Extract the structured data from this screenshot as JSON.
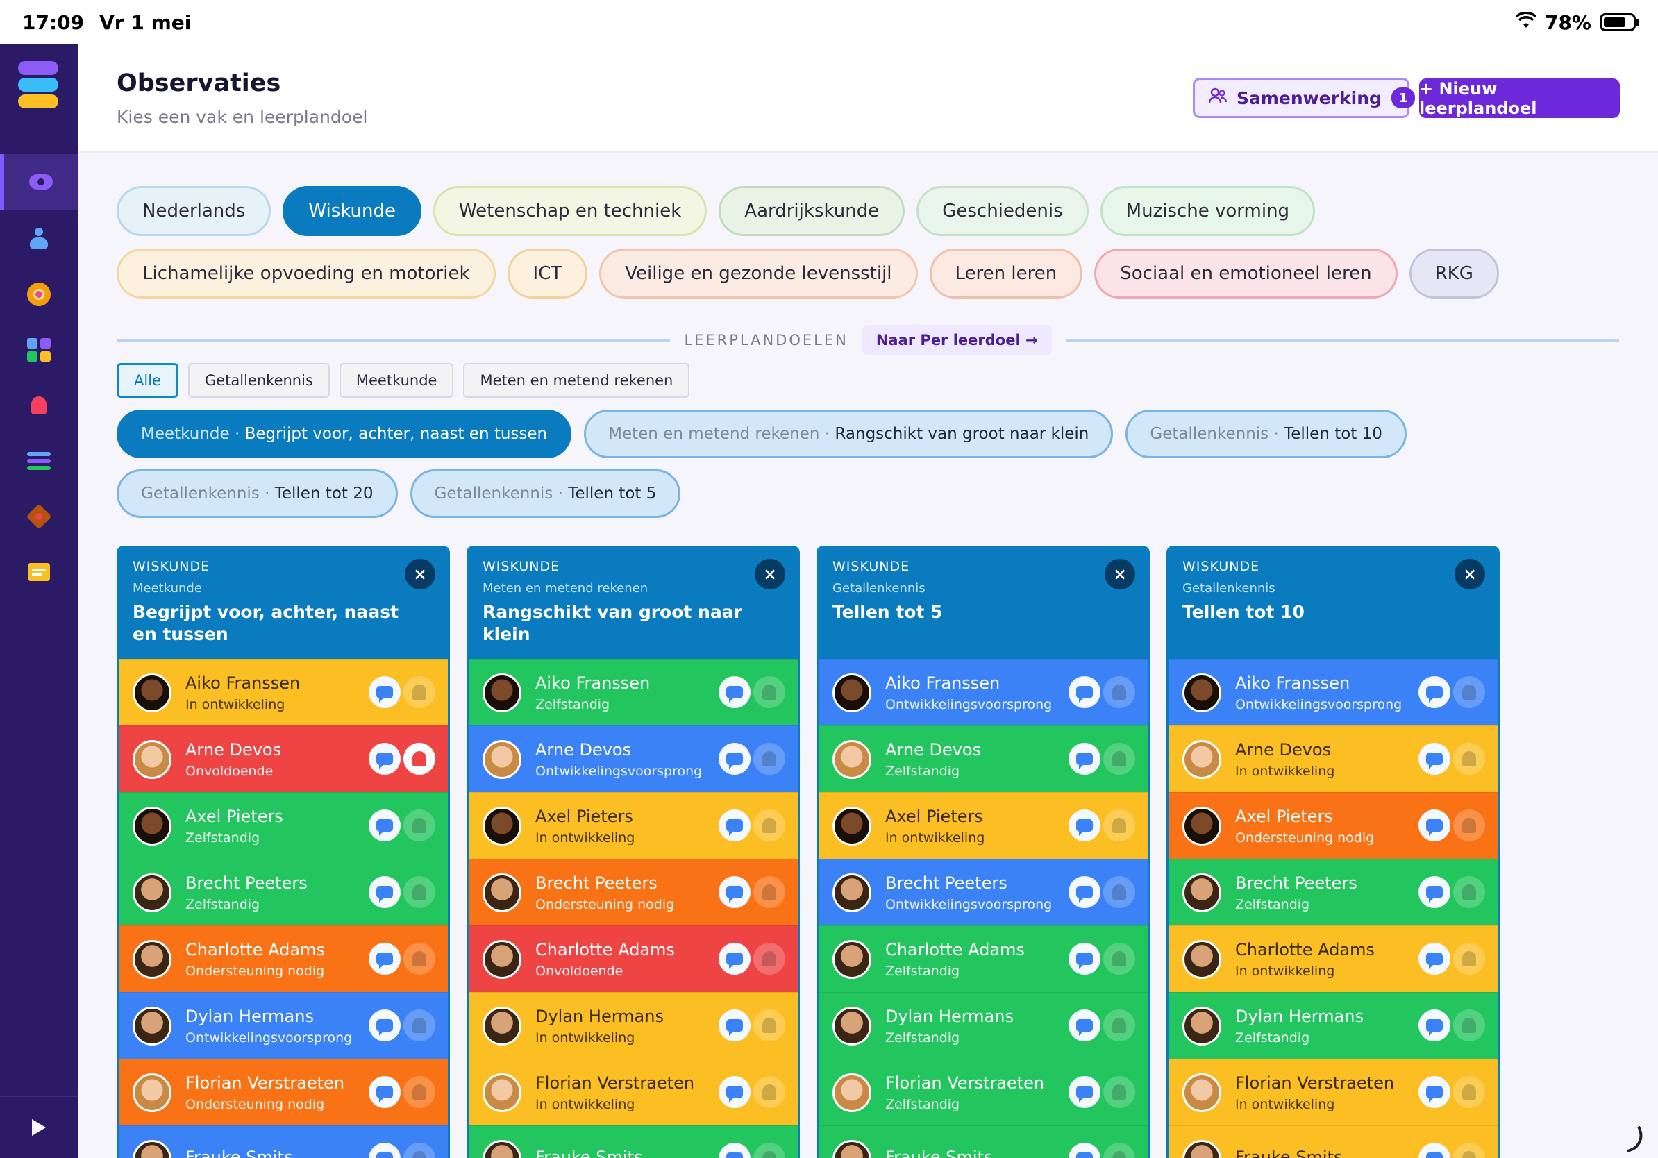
{
  "statusbar": {
    "time": "17:09",
    "date": "Vr 1 mei",
    "battery": "78%"
  },
  "header": {
    "title": "Observaties",
    "subtitle": "Kies een vak en leerplandoel",
    "collab_label": "Samenwerking",
    "collab_count": "1",
    "new_label": "+ Nieuw leerplandoel"
  },
  "subjects": [
    {
      "label": "Nederlands",
      "bg": "#e6f1f8",
      "border": "#b9d8ec",
      "active": false
    },
    {
      "label": "Wiskunde",
      "bg": "#0b7bc0",
      "border": "#0b7bc0",
      "active": true
    },
    {
      "label": "Wetenschap en techniek",
      "bg": "#f2f6e2",
      "border": "#d6e4ae",
      "active": false
    },
    {
      "label": "Aardrijkskunde",
      "bg": "#e8f3e6",
      "border": "#c2dcbd",
      "active": false
    },
    {
      "label": "Geschiedenis",
      "bg": "#e9f5ea",
      "border": "#c5e2c9",
      "active": false
    },
    {
      "label": "Muzische vorming",
      "bg": "#e6f6e9",
      "border": "#bfe5c7",
      "active": false
    },
    {
      "label": "Lichamelijke opvoeding en motoriek",
      "bg": "#fbf1de",
      "border": "#f2d89e",
      "active": false
    },
    {
      "label": "ICT",
      "bg": "#fbf1de",
      "border": "#f0d39a",
      "active": false
    },
    {
      "label": "Veilige en gezonde levensstijl",
      "bg": "#fcebe2",
      "border": "#f2c6ad",
      "active": false
    },
    {
      "label": "Leren leren",
      "bg": "#fbe9e2",
      "border": "#f1bfa9",
      "active": false
    },
    {
      "label": "Sociaal en emotioneel leren",
      "bg": "#fbe4e7",
      "border": "#f0a8b2",
      "active": false
    },
    {
      "label": "RKG",
      "bg": "#e6e6f4",
      "border": "#c3c3e0",
      "active": false
    }
  ],
  "leerplandoelen": {
    "label": "LEERPLANDOELEN",
    "link": "Naar Per leerdoel →"
  },
  "filters": [
    {
      "label": "Alle",
      "active": true
    },
    {
      "label": "Getallenkennis",
      "active": false
    },
    {
      "label": "Meetkunde",
      "active": false
    },
    {
      "label": "Meten en metend rekenen",
      "active": false
    }
  ],
  "goals": [
    {
      "domain": "Meetkunde",
      "sep": " · ",
      "goal": "Begrijpt voor, achter, naast en tussen",
      "active": true
    },
    {
      "domain": "Meten en metend rekenen",
      "sep": " · ",
      "goal": "Rangschikt van groot naar klein",
      "active": false
    },
    {
      "domain": "Getallenkennis",
      "sep": " · ",
      "goal": "Tellen tot 10",
      "active": false
    },
    {
      "domain": "Getallenkennis",
      "sep": " · ",
      "goal": "Tellen tot 20",
      "active": false
    },
    {
      "domain": "Getallenkennis",
      "sep": " · ",
      "goal": "Tellen tot 5",
      "active": false
    }
  ],
  "columns": [
    {
      "subject": "WISKUNDE",
      "domain": "Meetkunde",
      "goal": "Begrijpt voor, achter, naast en tussen",
      "close": "×",
      "rows": [
        {
          "name": "Aiko Franssen",
          "status": "In ontwikkeling",
          "color": "yellow",
          "bell": false
        },
        {
          "name": "Arne Devos",
          "status": "Onvoldoende",
          "color": "red",
          "bell": true
        },
        {
          "name": "Axel Pieters",
          "status": "Zelfstandig",
          "color": "green",
          "bell": false
        },
        {
          "name": "Brecht Peeters",
          "status": "Zelfstandig",
          "color": "green",
          "bell": false
        },
        {
          "name": "Charlotte Adams",
          "status": "Ondersteuning nodig",
          "color": "orange",
          "bell": false
        },
        {
          "name": "Dylan Hermans",
          "status": "Ontwikkelingsvoorsprong",
          "color": "blue",
          "bell": false
        },
        {
          "name": "Florian Verstraeten",
          "status": "Ondersteuning nodig",
          "color": "orange",
          "bell": false
        },
        {
          "name": "Frauke Smits",
          "status": "",
          "color": "blue",
          "bell": false
        }
      ]
    },
    {
      "subject": "WISKUNDE",
      "domain": "Meten en metend rekenen",
      "goal": "Rangschikt van groot naar klein",
      "close": "×",
      "rows": [
        {
          "name": "Aiko Franssen",
          "status": "Zelfstandig",
          "color": "green",
          "bell": false
        },
        {
          "name": "Arne Devos",
          "status": "Ontwikkelingsvoorsprong",
          "color": "blue",
          "bell": false
        },
        {
          "name": "Axel Pieters",
          "status": "In ontwikkeling",
          "color": "yellow",
          "bell": false
        },
        {
          "name": "Brecht Peeters",
          "status": "Ondersteuning nodig",
          "color": "orange",
          "bell": false
        },
        {
          "name": "Charlotte Adams",
          "status": "Onvoldoende",
          "color": "red",
          "bell": false
        },
        {
          "name": "Dylan Hermans",
          "status": "In ontwikkeling",
          "color": "yellow",
          "bell": false
        },
        {
          "name": "Florian Verstraeten",
          "status": "In ontwikkeling",
          "color": "yellow",
          "bell": false
        },
        {
          "name": "Frauke Smits",
          "status": "",
          "color": "green",
          "bell": false
        }
      ]
    },
    {
      "subject": "WISKUNDE",
      "domain": "Getallenkennis",
      "goal": "Tellen tot 5",
      "close": "×",
      "rows": [
        {
          "name": "Aiko Franssen",
          "status": "Ontwikkelingsvoorsprong",
          "color": "blue",
          "bell": false
        },
        {
          "name": "Arne Devos",
          "status": "Zelfstandig",
          "color": "green",
          "bell": false
        },
        {
          "name": "Axel Pieters",
          "status": "In ontwikkeling",
          "color": "yellow",
          "bell": false
        },
        {
          "name": "Brecht Peeters",
          "status": "Ontwikkelingsvoorsprong",
          "color": "blue",
          "bell": false
        },
        {
          "name": "Charlotte Adams",
          "status": "Zelfstandig",
          "color": "green",
          "bell": false
        },
        {
          "name": "Dylan Hermans",
          "status": "Zelfstandig",
          "color": "green",
          "bell": false
        },
        {
          "name": "Florian Verstraeten",
          "status": "Zelfstandig",
          "color": "green",
          "bell": false
        },
        {
          "name": "Frauke Smits",
          "status": "",
          "color": "green",
          "bell": false
        }
      ]
    },
    {
      "subject": "WISKUNDE",
      "domain": "Getallenkennis",
      "goal": "Tellen tot 10",
      "close": "×",
      "rows": [
        {
          "name": "Aiko Franssen",
          "status": "Ontwikkelingsvoorsprong",
          "color": "blue",
          "bell": false
        },
        {
          "name": "Arne Devos",
          "status": "In ontwikkeling",
          "color": "yellow",
          "bell": false
        },
        {
          "name": "Axel Pieters",
          "status": "Ondersteuning nodig",
          "color": "orange",
          "bell": false
        },
        {
          "name": "Brecht Peeters",
          "status": "Zelfstandig",
          "color": "green",
          "bell": false
        },
        {
          "name": "Charlotte Adams",
          "status": "In ontwikkeling",
          "color": "yellow",
          "bell": false
        },
        {
          "name": "Dylan Hermans",
          "status": "Zelfstandig",
          "color": "green",
          "bell": false
        },
        {
          "name": "Florian Verstraeten",
          "status": "In ontwikkeling",
          "color": "yellow",
          "bell": false
        },
        {
          "name": "Frauke Smits",
          "status": "",
          "color": "yellow",
          "bell": false
        }
      ]
    }
  ],
  "icons": {
    "logo": "app-logo-icon",
    "nav": [
      "observe-icon",
      "student-icon",
      "target-icon",
      "grid-icon",
      "bell-icon",
      "sliders-icon",
      "settings-icon",
      "notes-icon"
    ],
    "comment": "comment-icon",
    "bell": "bell-icon"
  },
  "colors": {
    "accent": "#6d28d9",
    "primary": "#0b7bc0",
    "sidebar": "#2b1a66"
  }
}
